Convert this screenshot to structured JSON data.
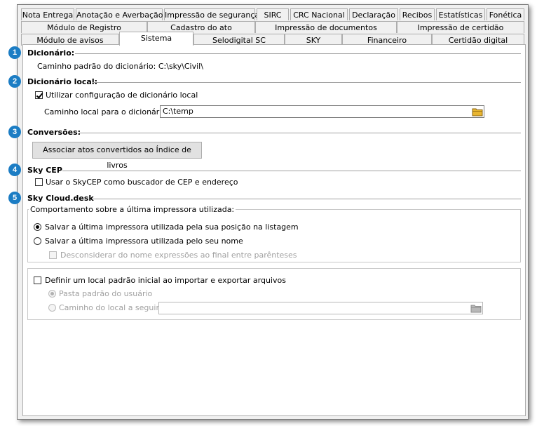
{
  "tabs": {
    "row1": [
      "Nota Entrega",
      "Anotação e Averbação",
      "Impressão de segurança",
      "SIRC",
      "CRC Nacional",
      "Declaração",
      "Recibos",
      "Estatísticas",
      "Fonética"
    ],
    "row2": [
      "Módulo de Registro",
      "Cadastro do ato",
      "Impressão de documentos",
      "Impressão de certidão"
    ],
    "row3": [
      "Módulo de avisos",
      "Sistema",
      "Selodigital SC",
      "SKY",
      "Financeiro",
      "Certidão digital"
    ],
    "active": "Sistema"
  },
  "badges": [
    "1",
    "2",
    "3",
    "4",
    "5"
  ],
  "dicionario": {
    "title": "Dicionário:",
    "path_text": "Caminho padrão do dicionário: C:\\sky\\Civil\\"
  },
  "dicionario_local": {
    "title": "Dicionário local:",
    "use_local_label": "Utilizar configuração de dicionário local",
    "use_local_checked": true,
    "path_label": "Caminho local para o dicionário:",
    "path_value": "C:\\temp"
  },
  "conversoes": {
    "title": "Conversões:",
    "button_label": "Associar atos convertidos ao Índice de livros"
  },
  "skycep": {
    "title": "Sky CEP",
    "use_label": "Usar o SkyCEP como buscador de CEP e endereço",
    "checked": false
  },
  "skycloud": {
    "title": "Sky Cloud.desk",
    "group_title": "Comportamento sobre a última impressora utilizada:",
    "opt_position": "Salvar a última impressora utilizada pela sua posição na listagem",
    "opt_name": "Salvar a última impressora utilizada pelo seu nome",
    "ignore_label": "Desconsiderar do nome expressões ao final entre parênteses",
    "default_location_label": "Definir um local padrão inicial ao importar e exportar arquivos",
    "opt_user_folder": "Pasta padrão do usuário",
    "opt_custom_path": "Caminho do local a seguir:",
    "custom_path_value": ""
  },
  "colors": {
    "badge": "#1c7dc4",
    "folder": "#e8b530"
  }
}
